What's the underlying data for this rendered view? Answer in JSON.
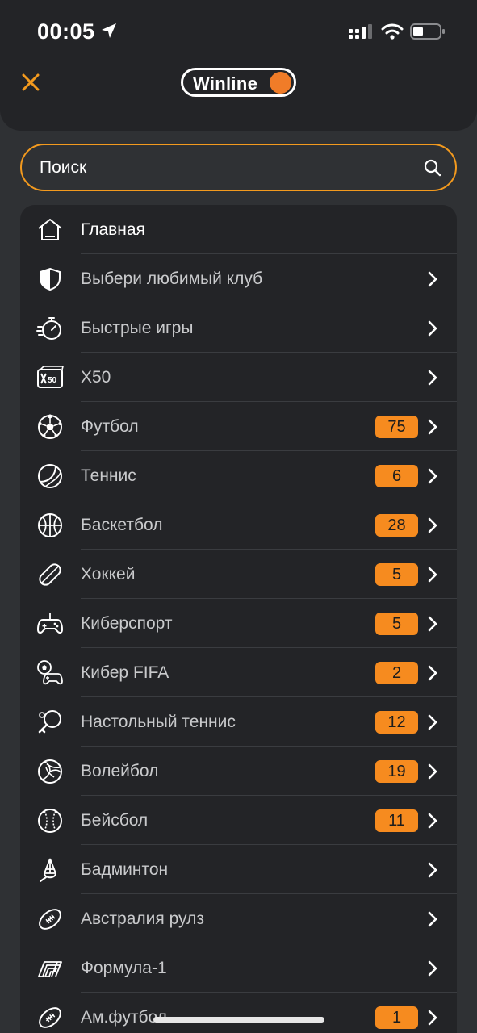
{
  "status_bar": {
    "time": "00:05"
  },
  "header": {
    "logo_text": "Winline"
  },
  "search": {
    "placeholder": "Поиск"
  },
  "menu": {
    "items": [
      {
        "label": "Главная",
        "icon": "home-icon",
        "badge": "",
        "chevron": false
      },
      {
        "label": "Выбери любимый клуб",
        "icon": "shield-icon",
        "badge": "",
        "chevron": true
      },
      {
        "label": "Быстрые игры",
        "icon": "stopwatch-icon",
        "badge": "",
        "chevron": true
      },
      {
        "label": "X50",
        "icon": "x50-icon",
        "badge": "",
        "chevron": true
      },
      {
        "label": "Футбол",
        "icon": "football-icon",
        "badge": "75",
        "chevron": true
      },
      {
        "label": "Теннис",
        "icon": "tennis-icon",
        "badge": "6",
        "chevron": true
      },
      {
        "label": "Баскетбол",
        "icon": "basketball-icon",
        "badge": "28",
        "chevron": true
      },
      {
        "label": "Хоккей",
        "icon": "hockey-icon",
        "badge": "5",
        "chevron": true
      },
      {
        "label": "Киберспорт",
        "icon": "gamepad-icon",
        "badge": "5",
        "chevron": true
      },
      {
        "label": "Кибер FIFA",
        "icon": "cyber-fifa-icon",
        "badge": "2",
        "chevron": true
      },
      {
        "label": "Настольный теннис",
        "icon": "table-tennis-icon",
        "badge": "12",
        "chevron": true
      },
      {
        "label": "Волейбол",
        "icon": "volleyball-icon",
        "badge": "19",
        "chevron": true
      },
      {
        "label": "Бейсбол",
        "icon": "baseball-icon",
        "badge": "11",
        "chevron": true
      },
      {
        "label": "Бадминтон",
        "icon": "shuttlecock-icon",
        "badge": "",
        "chevron": true
      },
      {
        "label": "Австралия рулз",
        "icon": "rugby-ball-icon",
        "badge": "",
        "chevron": true
      },
      {
        "label": "Формула-1",
        "icon": "formula1-icon",
        "badge": "",
        "chevron": true
      },
      {
        "label": "Ам.футбол",
        "icon": "american-football-icon",
        "badge": "1",
        "chevron": true
      }
    ]
  },
  "colors": {
    "accent": "#f68b1f",
    "background": "#232427",
    "page": "#2f3134",
    "text": "#c9cacc"
  }
}
